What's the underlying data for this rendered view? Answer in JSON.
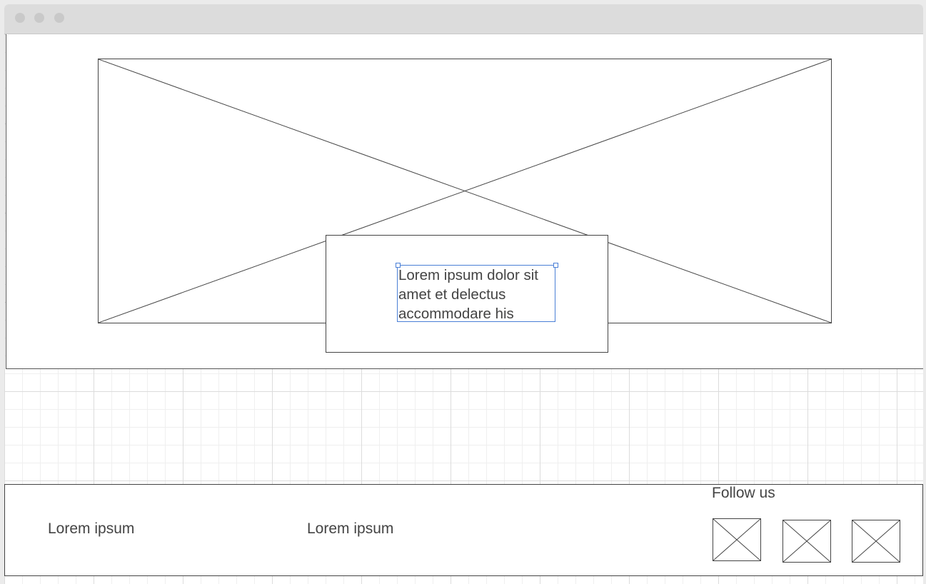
{
  "hero": {
    "image_icon": "image-placeholder-icon",
    "callout_text": "Lorem ipsum dolor sit amet et delectus accommodare his"
  },
  "footer": {
    "column_1": "Lorem ipsum",
    "column_2": "Lorem ipsum",
    "follow_title": "Follow us",
    "social_icons": [
      "image-placeholder-icon",
      "image-placeholder-icon",
      "image-placeholder-icon"
    ]
  },
  "colors": {
    "selection_outline": "#4a7fd6",
    "text": "#444444",
    "grid": "#dcdcdc"
  }
}
